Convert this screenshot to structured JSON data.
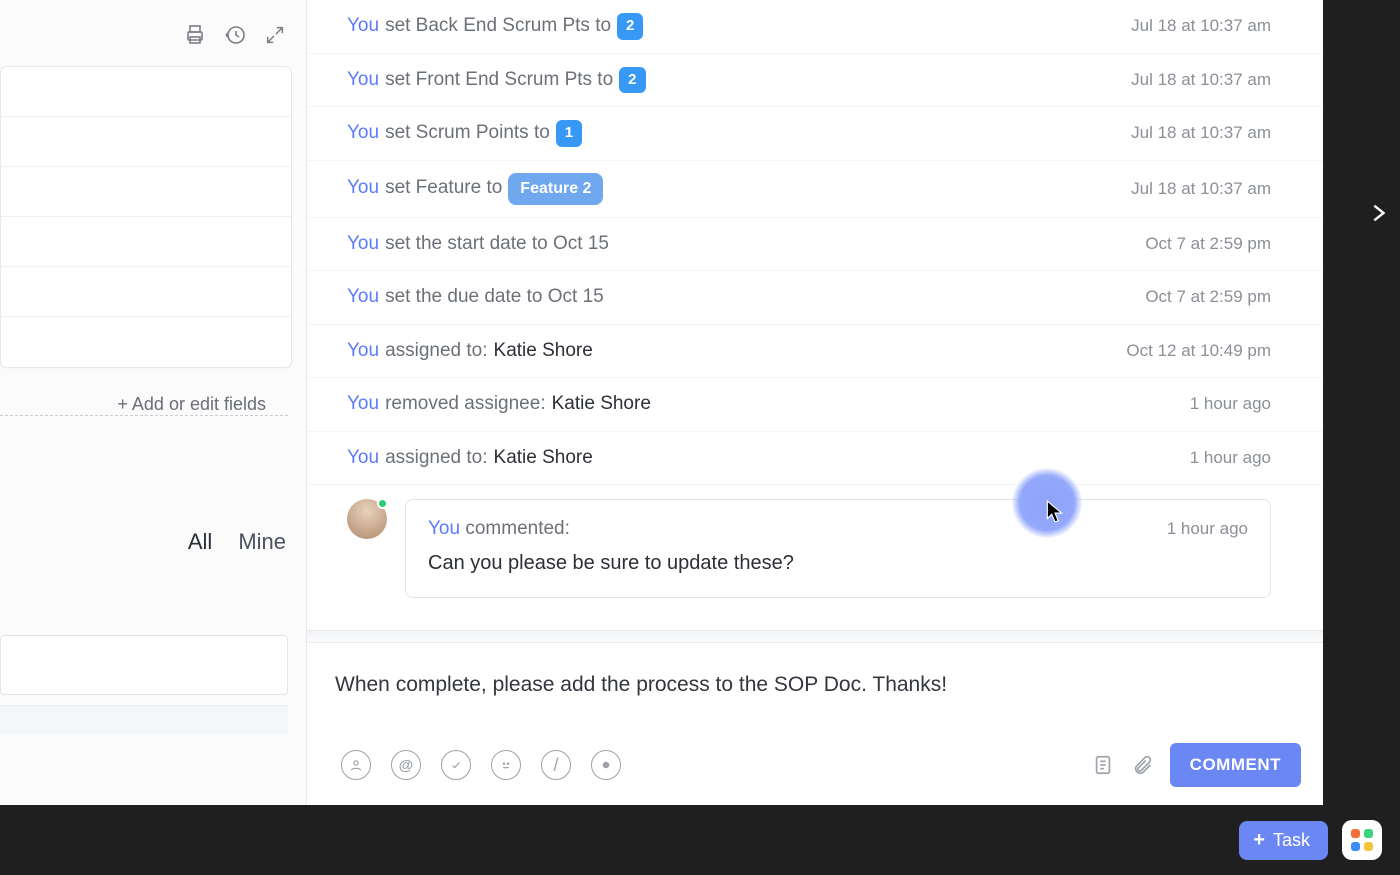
{
  "sidebar": {
    "add_fields_label": "+ Add or edit fields",
    "tabs": {
      "all": "All",
      "mine": "Mine"
    }
  },
  "activity": [
    {
      "actor": "You",
      "text_before": "set Back End Scrum Pts to",
      "pill": "2",
      "pill_type": "num",
      "ts": "Jul 18 at 10:37 am"
    },
    {
      "actor": "You",
      "text_before": "set Front End Scrum Pts to",
      "pill": "2",
      "pill_type": "num",
      "ts": "Jul 18 at 10:37 am"
    },
    {
      "actor": "You",
      "text_before": "set Scrum Points to",
      "pill": "1",
      "pill_type": "num",
      "ts": "Jul 18 at 10:37 am"
    },
    {
      "actor": "You",
      "text_before": "set Feature to",
      "pill": "Feature 2",
      "pill_type": "feat",
      "ts": "Jul 18 at 10:37 am"
    },
    {
      "actor": "You",
      "text_before": "set the start date to Oct 15",
      "ts": "Oct 7 at 2:59 pm"
    },
    {
      "actor": "You",
      "text_before": "set the due date to Oct 15",
      "ts": "Oct 7 at 2:59 pm"
    },
    {
      "actor": "You",
      "text_before": "assigned to:",
      "assignee": "Katie Shore",
      "ts": "Oct 12 at 10:49 pm"
    },
    {
      "actor": "You",
      "text_before": "removed assignee:",
      "assignee": "Katie Shore",
      "ts": "1 hour ago"
    },
    {
      "actor": "You",
      "text_before": "assigned to:",
      "assignee": "Katie Shore",
      "ts": "1 hour ago"
    }
  ],
  "comment": {
    "actor": "You",
    "verb": "commented:",
    "body": "Can you please be sure to update these?",
    "ts": "1 hour ago"
  },
  "composer": {
    "text": "When complete, please add the process to the SOP Doc. Thanks!",
    "submit_label": "COMMENT"
  },
  "bottombar": {
    "task_label": "Task"
  }
}
